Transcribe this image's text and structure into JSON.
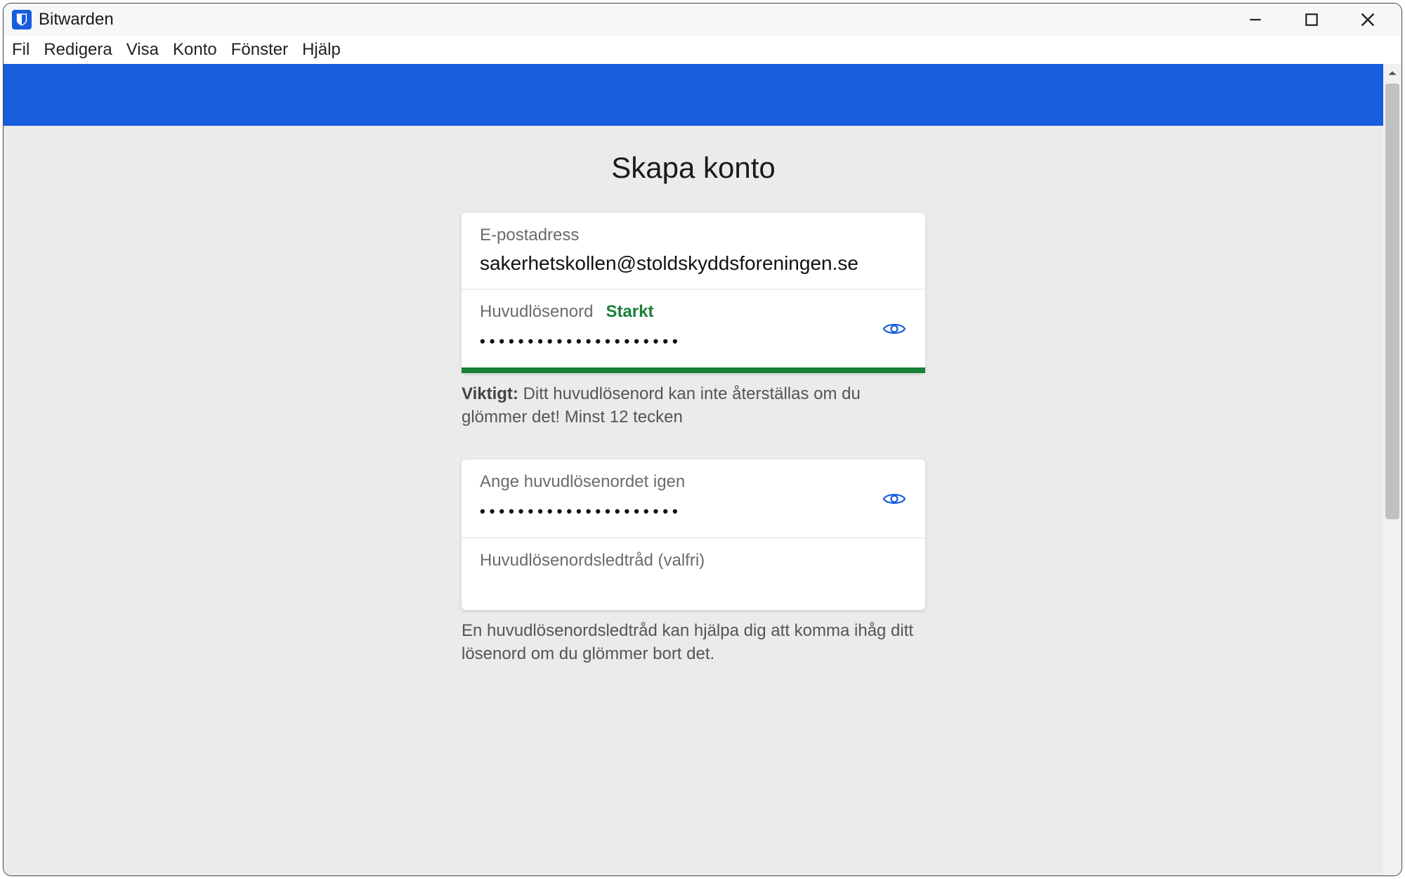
{
  "window": {
    "title": "Bitwarden"
  },
  "menu": {
    "file": "Fil",
    "edit": "Redigera",
    "view": "Visa",
    "account": "Konto",
    "window": "Fönster",
    "help": "Hjälp"
  },
  "page": {
    "title": "Skapa konto"
  },
  "form": {
    "email_label": "E-postadress",
    "email_value": "sakerhetskollen@stoldskyddsforeningen.se",
    "password_label": "Huvudlösenord",
    "password_strength": "Starkt",
    "password_masked": "•••••••••••••••••••••",
    "important_label": "Viktigt:",
    "important_text": " Ditt huvudlösenord kan inte återställas om du glömmer det! Minst 12 tecken",
    "confirm_label": "Ange huvudlösenordet igen",
    "confirm_masked": "•••••••••••••••••••••",
    "hint_label": "Huvudlösenordsledtråd (valfri)",
    "hint_help": "En huvudlösenordsledtråd kan hjälpa dig att komma ihåg ditt lösenord om du glömmer bort det."
  },
  "colors": {
    "accent": "#175ddc",
    "success": "#198038"
  }
}
